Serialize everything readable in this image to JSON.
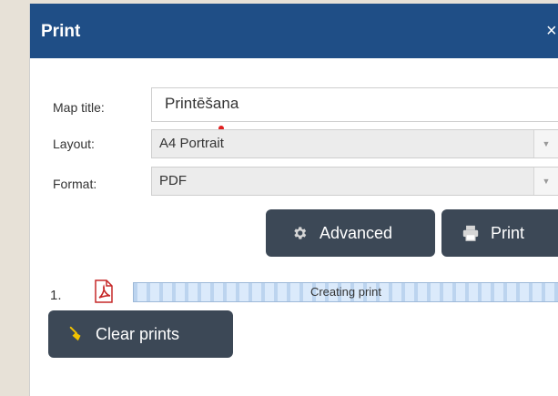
{
  "dialog": {
    "title": "Print",
    "close_glyph": "×"
  },
  "form": {
    "map_title_label": "Map title:",
    "map_title_value": "Printēšana",
    "layout_label": "Layout:",
    "layout_value": "A4 Portrait",
    "format_label": "Format:",
    "format_value": "PDF"
  },
  "buttons": {
    "advanced_label": "Advanced",
    "print_label": "Print",
    "clear_label": "Clear prints"
  },
  "prints": [
    {
      "index": "1.",
      "status": "Creating print"
    }
  ],
  "icons": {
    "advanced": "gear-icon",
    "print": "printer-icon",
    "pdf": "pdf-file-icon",
    "clear": "broom-icon",
    "dropdown": "chevron-down-icon",
    "close": "close-icon"
  },
  "colors": {
    "titlebar": "#1f4e86",
    "button": "#3c4856",
    "progress": "#cfe2f7",
    "marker": "#e02020"
  }
}
